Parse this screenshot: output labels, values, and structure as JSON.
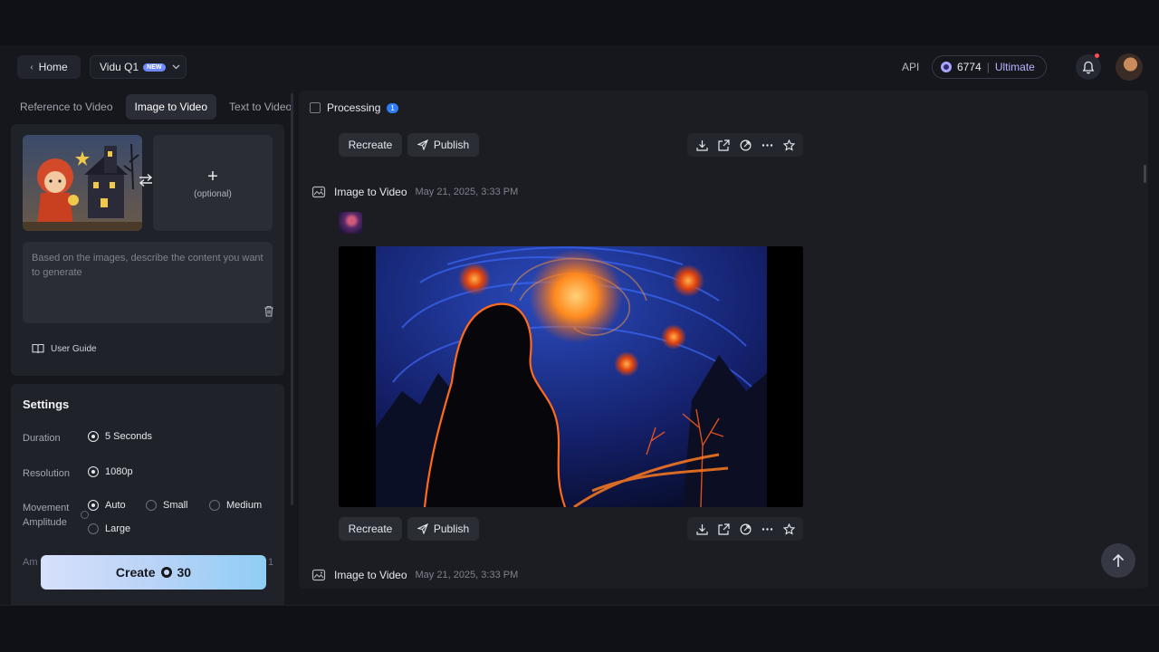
{
  "header": {
    "home_label": "Home",
    "model_label": "Vidu Q1",
    "model_badge": "NEW",
    "api_label": "API",
    "credits": "6774",
    "tier": "Ultimate"
  },
  "tabs": [
    {
      "label": "Reference to Video",
      "active": false
    },
    {
      "label": "Image to Video",
      "active": true
    },
    {
      "label": "Text to Video",
      "active": false
    }
  ],
  "upload": {
    "optional_label": "(optional)",
    "prompt_placeholder": "Based on the images, describe the content you want to generate",
    "user_guide": "User Guide"
  },
  "settings": {
    "title": "Settings",
    "duration_label": "Duration",
    "duration_value": "5 Seconds",
    "resolution_label": "Resolution",
    "resolution_value": "1080p",
    "movement_label": "Movement Amplitude",
    "movement_options": [
      "Auto",
      "Small",
      "Medium",
      "Large"
    ],
    "movement_selected": "Auto",
    "peek_left": "Am",
    "peek_right": "1"
  },
  "create": {
    "label": "Create",
    "cost": "30"
  },
  "results": {
    "processing_label": "Processing",
    "processing_count": "1",
    "recreate_label": "Recreate",
    "publish_label": "Publish",
    "item_type": "Image to Video",
    "item_date": "May 21, 2025, 3:33 PM"
  },
  "colors": {
    "accent_blue": "#2f7cf6",
    "credits_purple": "#a9a6ff",
    "create_gradient_end": "#8fcdf5"
  }
}
